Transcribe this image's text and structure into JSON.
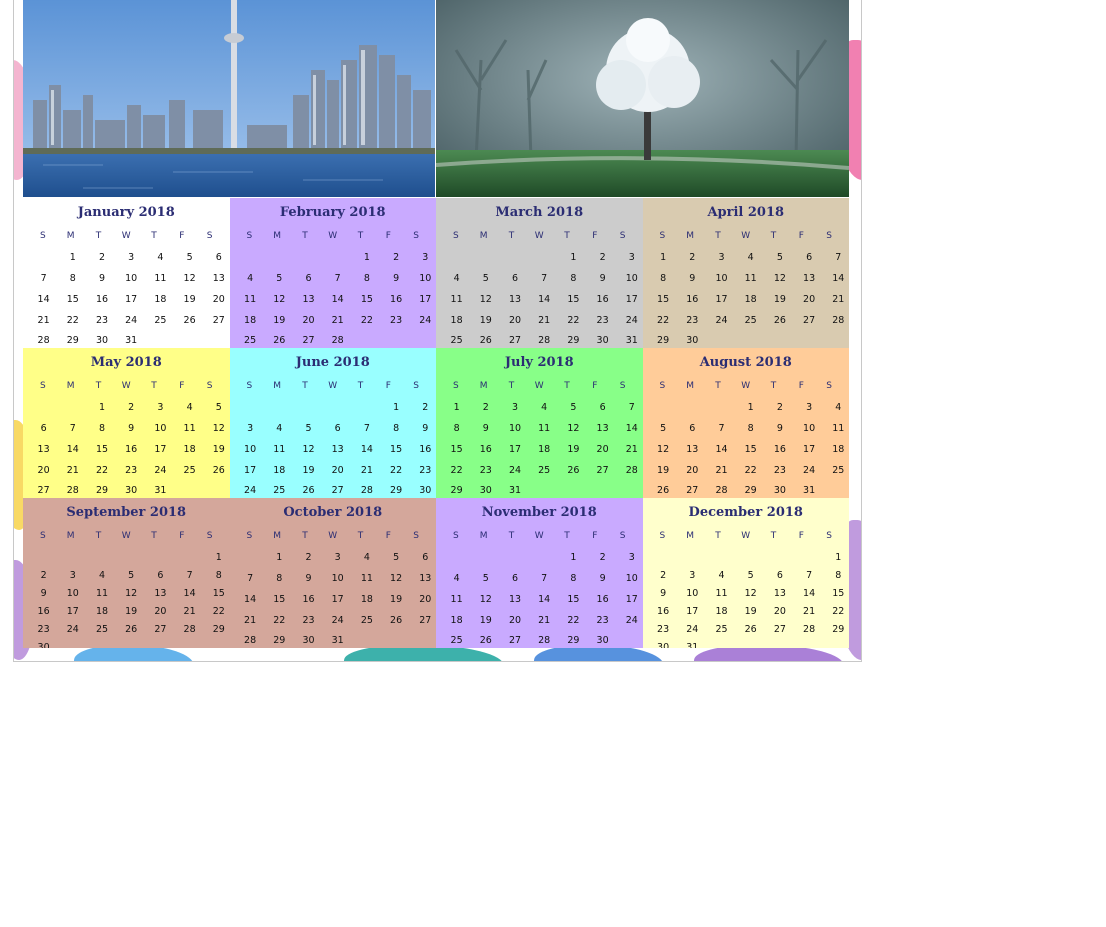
{
  "photos": [
    {
      "subject": "city-skyline-photo"
    },
    {
      "subject": "misty-tree-photo"
    }
  ],
  "weekday_labels": [
    "S",
    "M",
    "T",
    "W",
    "T",
    "F",
    "S"
  ],
  "months": [
    {
      "name": "January 2018",
      "color": "#ffffff",
      "start": 1,
      "days": 31
    },
    {
      "name": "February 2018",
      "color": "#c9aaff",
      "start": 4,
      "days": 28
    },
    {
      "name": "March 2018",
      "color": "#cccccc",
      "start": 4,
      "days": 31
    },
    {
      "name": "April 2018",
      "color": "#d9cbb0",
      "start": 0,
      "days": 30
    },
    {
      "name": "May 2018",
      "color": "#ffff88",
      "start": 2,
      "days": 31
    },
    {
      "name": "June 2018",
      "color": "#99ffff",
      "start": 5,
      "days": 30
    },
    {
      "name": "July 2018",
      "color": "#88ff88",
      "start": 0,
      "days": 31
    },
    {
      "name": "August 2018",
      "color": "#ffcc99",
      "start": 3,
      "days": 31
    },
    {
      "name": "September 2018",
      "color": "#d4a79b",
      "start": 6,
      "days": 30
    },
    {
      "name": "October 2018",
      "color": "#d4a79b",
      "start": 1,
      "days": 31
    },
    {
      "name": "November 2018",
      "color": "#c9aaff",
      "start": 4,
      "days": 30
    },
    {
      "name": "December 2018",
      "color": "#ffffcc",
      "start": 6,
      "days": 31
    }
  ]
}
